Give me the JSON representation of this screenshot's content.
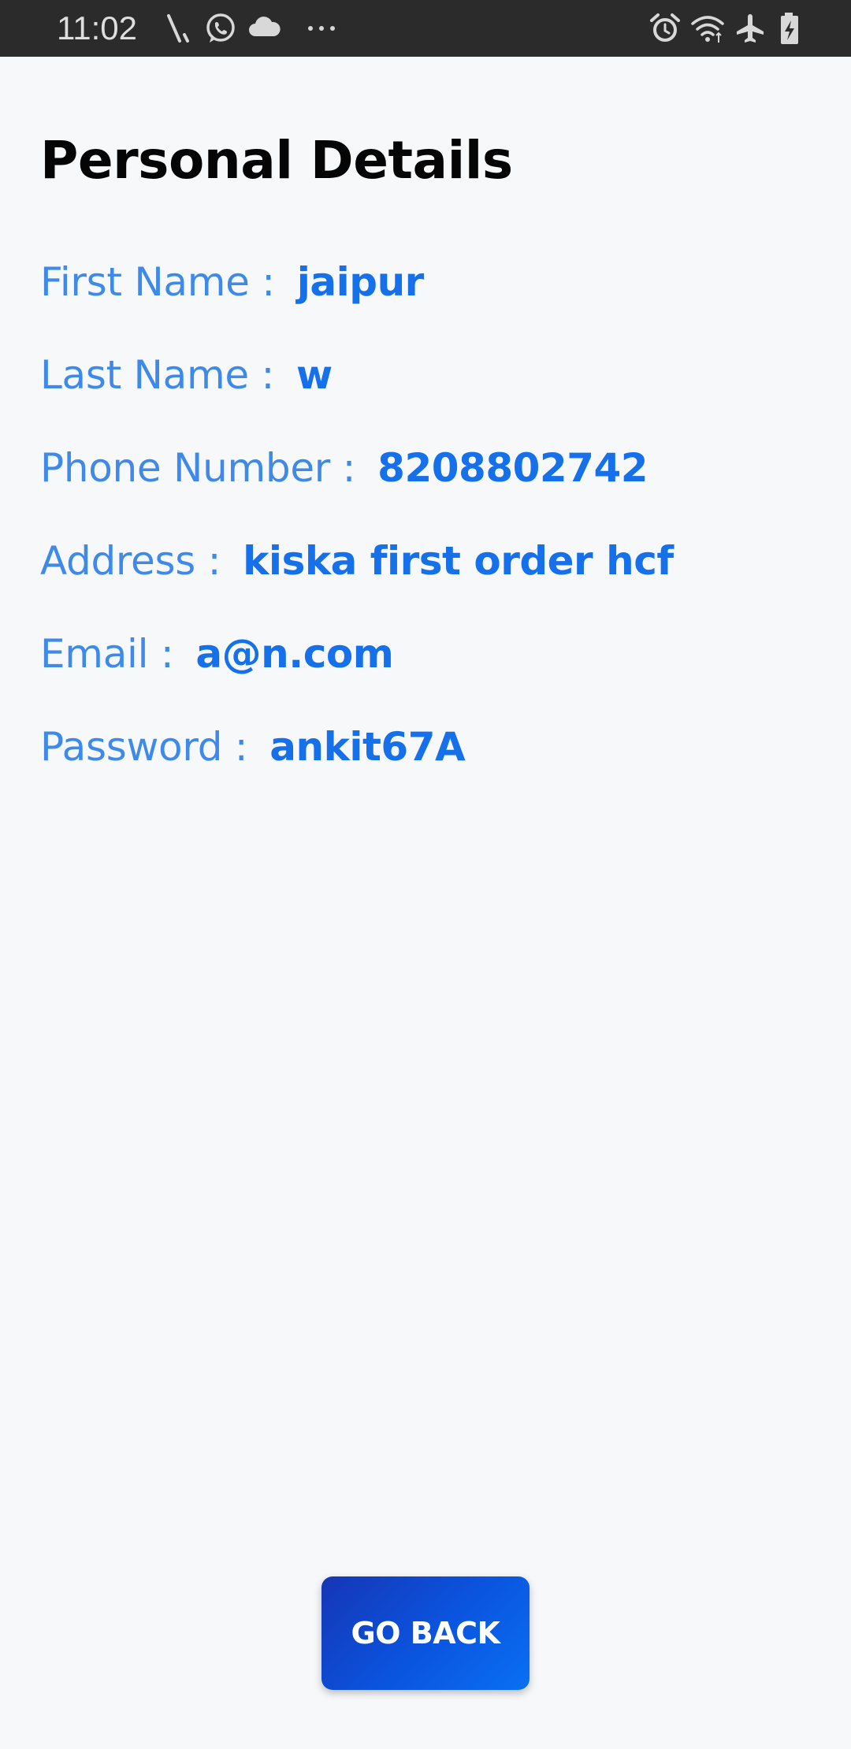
{
  "status_bar": {
    "time": "11:02",
    "left_icons": [
      "signal-slash-icon",
      "whatsapp-icon",
      "cloud-icon",
      "more-dots-icon"
    ],
    "right_icons": [
      "alarm-icon",
      "wifi-icon",
      "airplane-icon",
      "battery-charging-icon"
    ]
  },
  "page": {
    "title": "Personal Details"
  },
  "details": [
    {
      "label": "First Name :",
      "value": "jaipur"
    },
    {
      "label": "Last Name :",
      "value": "w"
    },
    {
      "label": "Phone Number :",
      "value": "8208802742"
    },
    {
      "label": "Address :",
      "value": "kiska first order hcf"
    },
    {
      "label": "Email :",
      "value": "a@n.com"
    },
    {
      "label": "Password :",
      "value": "ankit67A"
    }
  ],
  "actions": {
    "go_back_label": "GO BACK"
  },
  "colors": {
    "label": "#3f8ae8",
    "value": "#1570ea",
    "button_start": "#1636b6",
    "button_end": "#0970f2",
    "status_bar": "#2b2b2b",
    "background": "#f6f8fa"
  }
}
